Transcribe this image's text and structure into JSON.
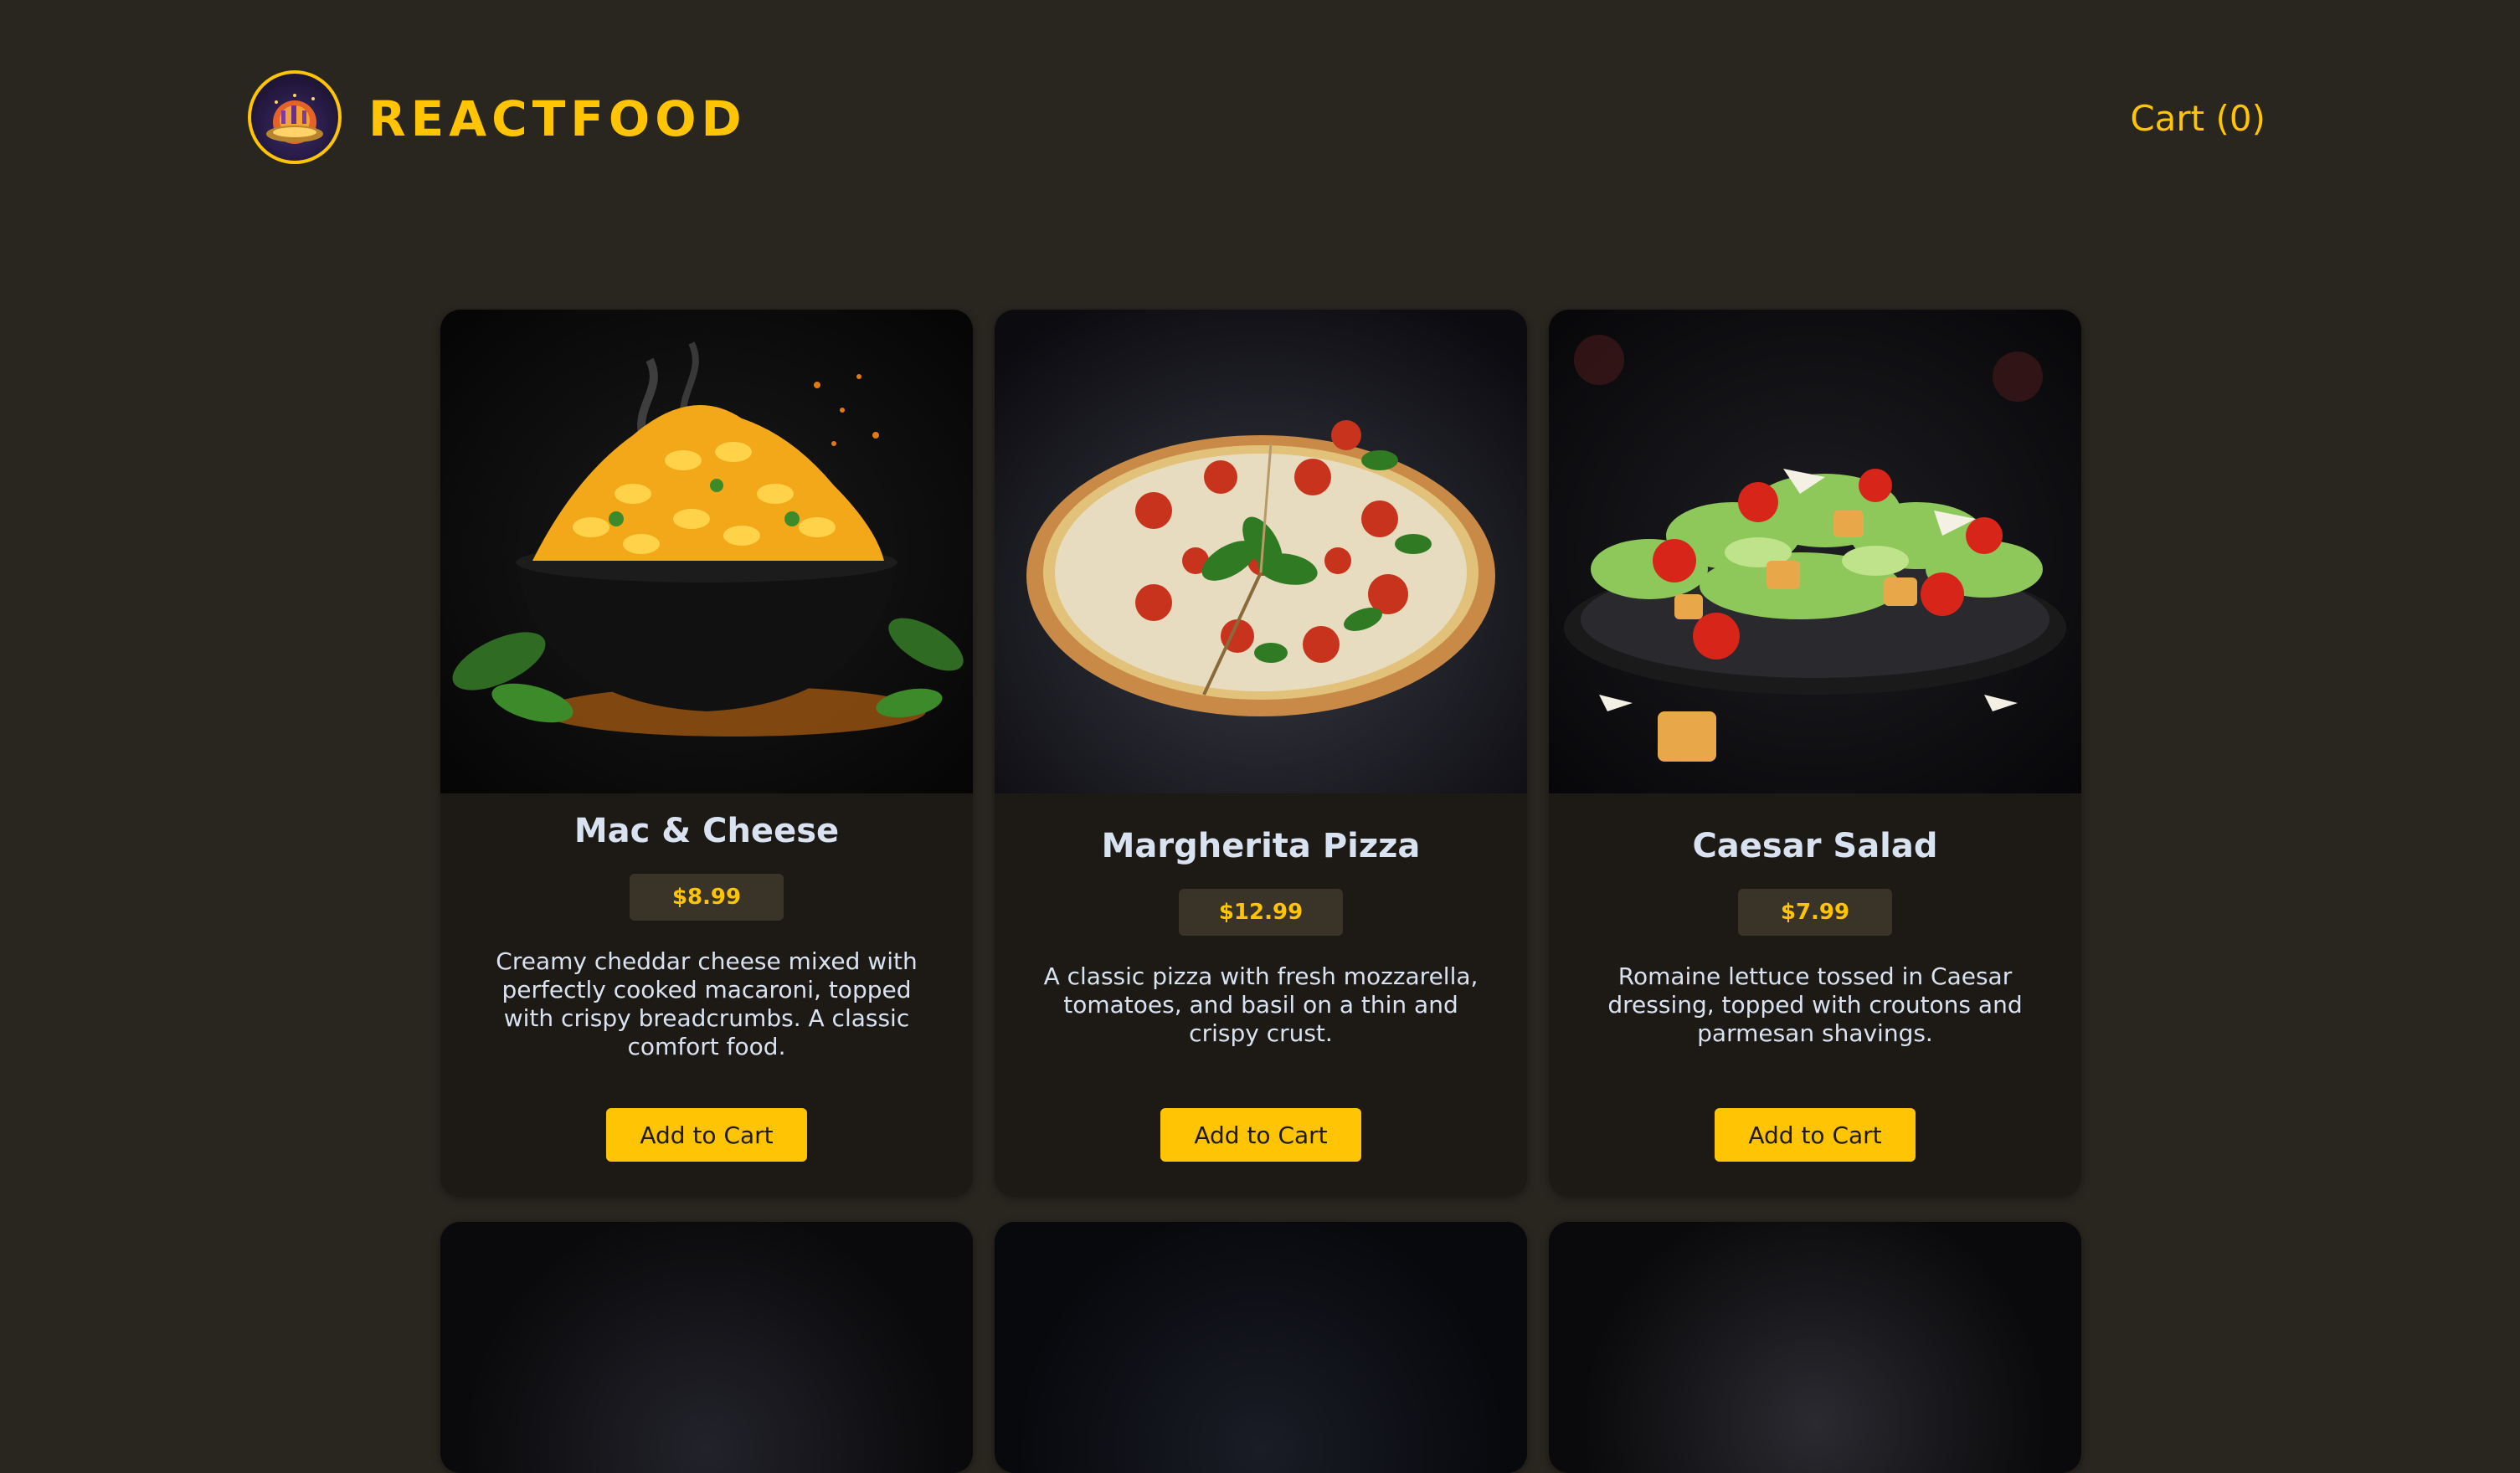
{
  "header": {
    "brand": "REACTFOOD",
    "logo_icon": "restaurant-logo-icon",
    "cart_label": "Cart (0)"
  },
  "colors": {
    "background": "#29251f",
    "accent": "#ffc404",
    "card": "#1d1a16",
    "price_badge": "#3a3328",
    "text": "#d9e2f1"
  },
  "meals": [
    {
      "name": "Mac & Cheese",
      "price": "$8.99",
      "description": "Creamy cheddar cheese mixed with perfectly cooked macaroni, topped with crispy breadcrumbs. A classic comfort food.",
      "button": "Add to Cart",
      "image": "mac-and-cheese-image"
    },
    {
      "name": "Margherita Pizza",
      "price": "$12.99",
      "description": "A classic pizza with fresh mozzarella, tomatoes, and basil on a thin and crispy crust.",
      "button": "Add to Cart",
      "image": "margherita-pizza-image"
    },
    {
      "name": "Caesar Salad",
      "price": "$7.99",
      "description": "Romaine lettuce tossed in Caesar dressing, topped with croutons and parmesan shavings.",
      "button": "Add to Cart",
      "image": "caesar-salad-image"
    }
  ]
}
